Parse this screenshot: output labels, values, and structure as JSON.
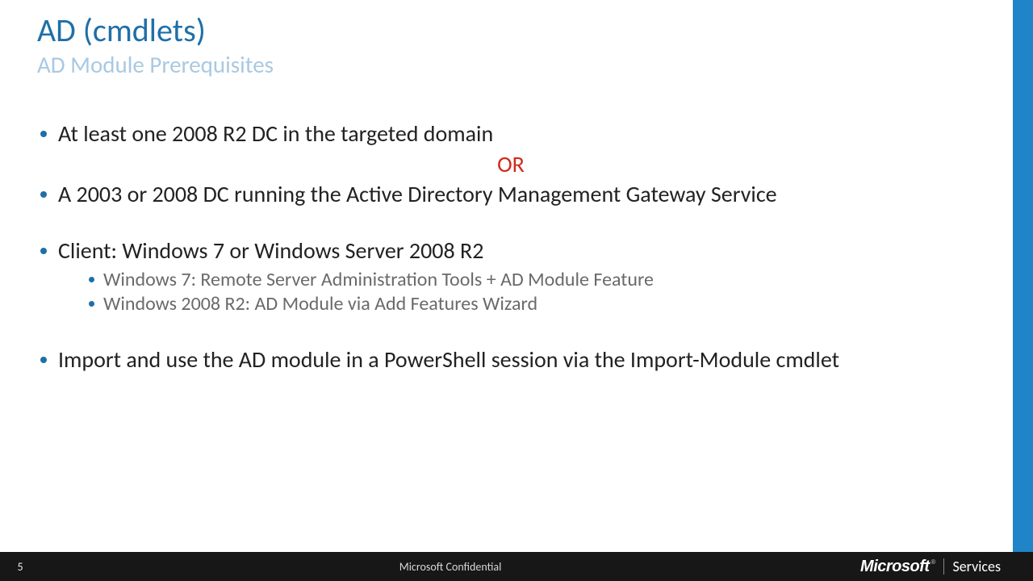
{
  "header": {
    "title": "AD (cmdlets)",
    "subtitle": "AD Module Prerequisites"
  },
  "body": {
    "bullet1": "At least one 2008 R2 DC in the targeted domain",
    "or": "OR",
    "bullet2": "A 2003 or 2008 DC running the Active Directory Management Gateway Service",
    "bullet3": "Client: Windows 7 or Windows Server 2008 R2",
    "bullet3_sub1": "Windows 7: Remote Server Administration Tools + AD Module Feature",
    "bullet3_sub2": "Windows 2008 R2: AD Module via Add Features Wizard",
    "bullet4": "Import and use the AD module in a PowerShell session via the Import-Module cmdlet"
  },
  "footer": {
    "page": "5",
    "confidential": "Microsoft Confidential",
    "brand_word": "Microsoft",
    "brand_tm": "®",
    "services": "Services"
  }
}
